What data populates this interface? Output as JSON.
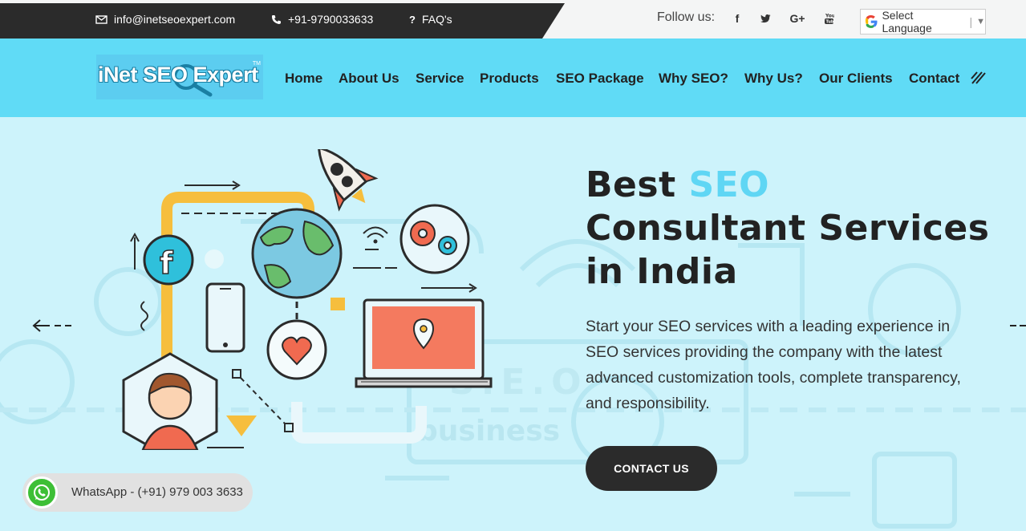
{
  "topbar": {
    "email": "info@inetseoexpert.com",
    "phone": "+91-9790033633",
    "faq": "FAQ's",
    "follow_label": "Follow us:",
    "social": [
      "facebook-icon",
      "twitter-icon",
      "google-plus-icon",
      "youtube-icon"
    ],
    "social_glyphs": [
      "f",
      "t",
      "G+",
      "You"
    ],
    "language_select": "Select Language"
  },
  "logo": {
    "text": "iNet SEO Expert",
    "tm": "TM"
  },
  "nav": {
    "items": [
      {
        "label": "Home"
      },
      {
        "label": "About Us"
      },
      {
        "label": "Service"
      },
      {
        "label": "Products"
      },
      {
        "label": "SEO Package"
      },
      {
        "label": "Why SEO?"
      },
      {
        "label": "Why Us?"
      },
      {
        "label": "Our Clients"
      },
      {
        "label": "Contact"
      }
    ]
  },
  "hero": {
    "headline_1": "Best",
    "headline_accent": "SEO",
    "headline_2": "Consultant Services",
    "headline_3": "in India",
    "description": "Start your SEO services with a leading experience in SEO services providing the company with the latest advanced customization tools, complete transparency, and responsibility.",
    "cta": "CONTACT US",
    "bg_word": "business",
    "bg_letters": "S.E.O"
  },
  "whatsapp": {
    "label": "WhatsApp - (+91) 979 003 3633"
  },
  "colors": {
    "accent": "#5fd6f4",
    "nav_bg": "#60dbf6",
    "dark": "#2b2b2b",
    "hero_bg": "#cdf3fb"
  }
}
